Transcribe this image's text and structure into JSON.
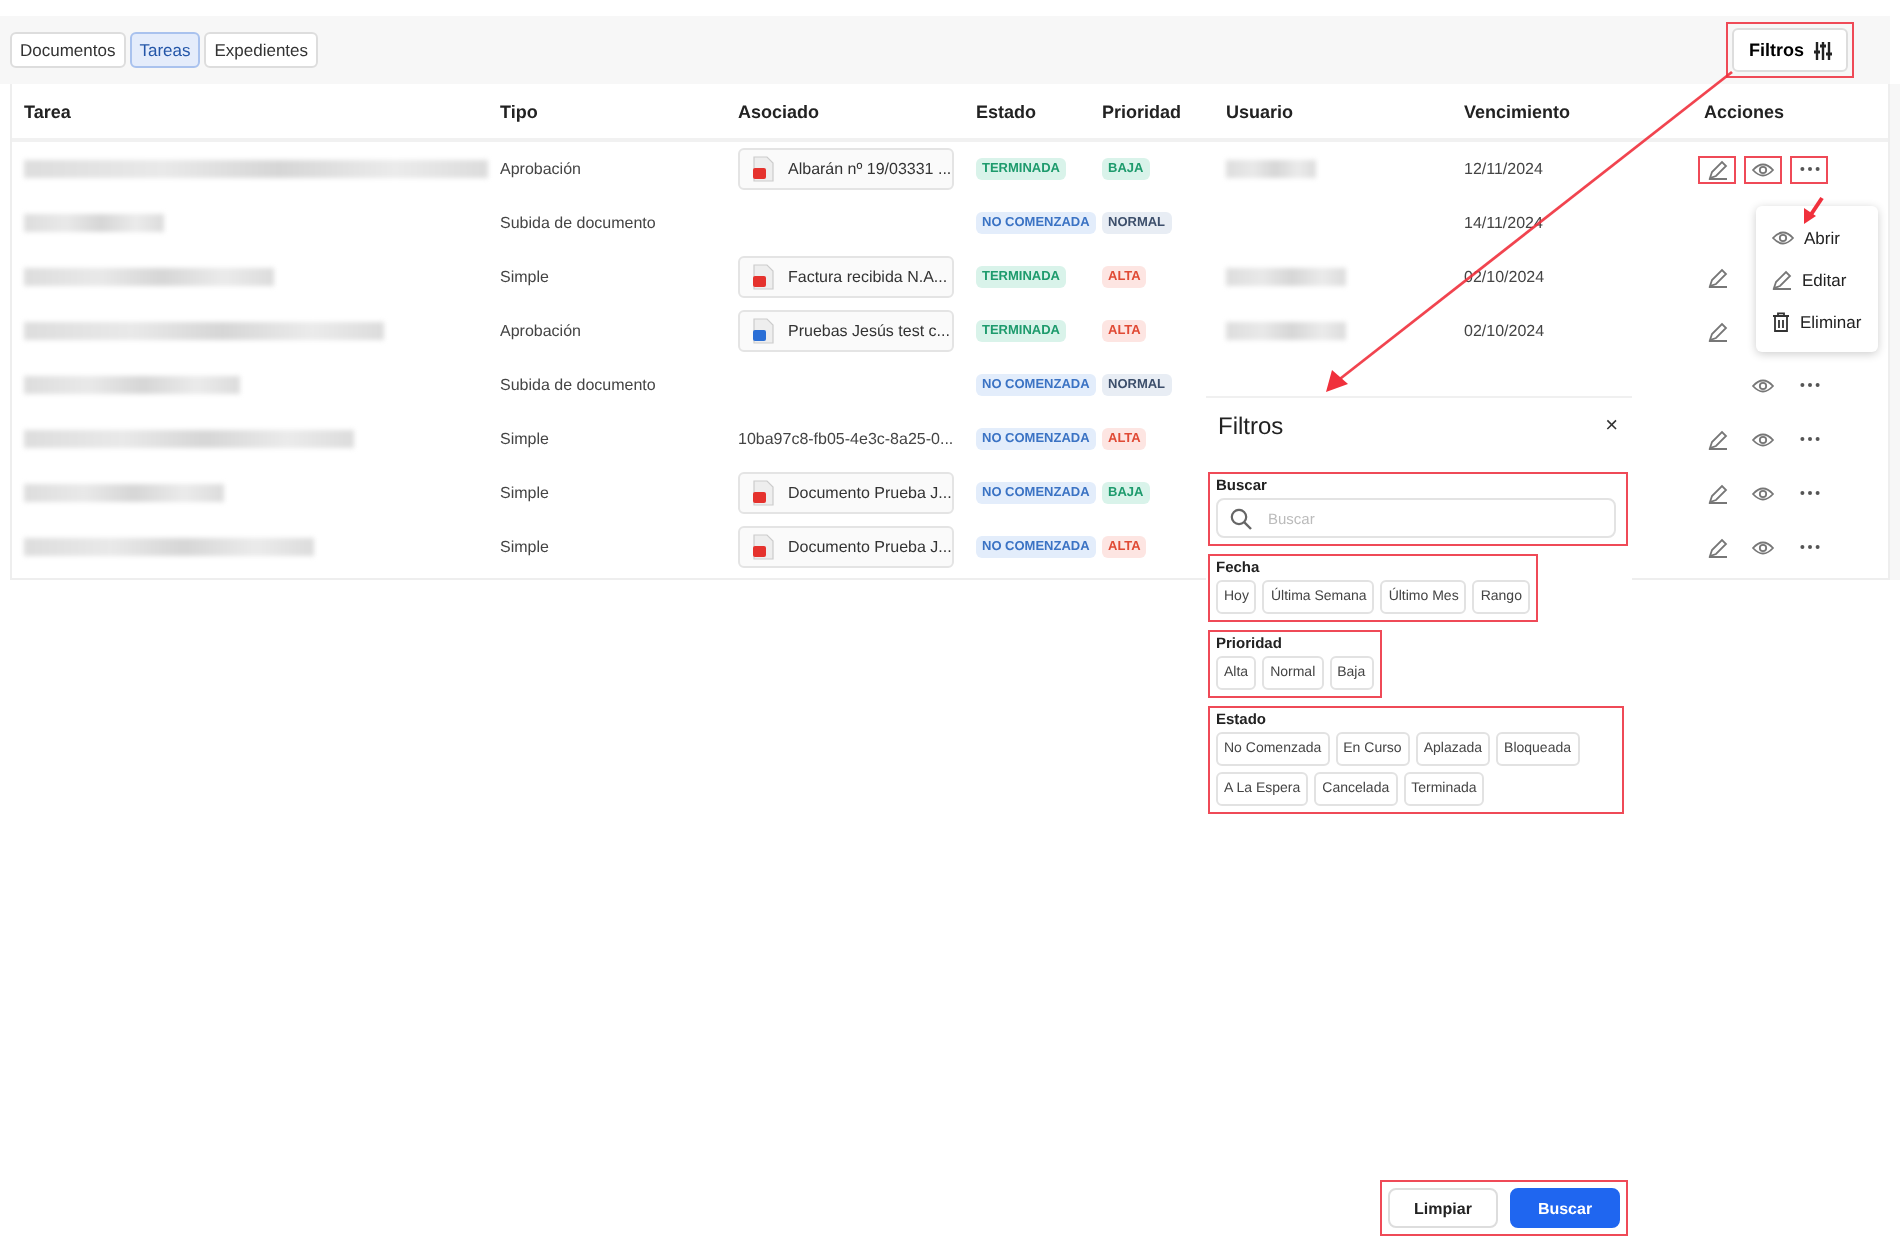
{
  "tabs": [
    {
      "label": "Documentos",
      "selected": false
    },
    {
      "label": "Tareas",
      "selected": true
    },
    {
      "label": "Expedientes",
      "selected": false
    }
  ],
  "filters_button": {
    "label": "Filtros",
    "highlighted": true
  },
  "table": {
    "columns": [
      "Tarea",
      "Tipo",
      "Asociado",
      "Estado",
      "Prioridad",
      "Usuario",
      "Vencimiento",
      "Acciones"
    ],
    "rows": [
      {
        "tipo": "Aprobación",
        "asociado": {
          "kind": "pdf",
          "text": "Albarán nº 19/03331 ..."
        },
        "estado": {
          "kind": "done",
          "text": "TERMINADA"
        },
        "prioridad": {
          "kind": "low",
          "text": "BAJA"
        },
        "usuario_redacted": true,
        "vencimiento": "12/11/2024",
        "actions": [
          {
            "kind": "edit",
            "highlighted": true
          },
          {
            "kind": "view",
            "highlighted": true
          },
          {
            "kind": "more",
            "highlighted": true
          }
        ]
      },
      {
        "tipo": "Subida de documento",
        "estado": {
          "kind": "new",
          "text": "NO COMENZADA"
        },
        "prioridad": {
          "kind": "normal",
          "text": "NORMAL"
        },
        "vencimiento": "14/11/2024"
      },
      {
        "tipo": "Simple",
        "asociado": {
          "kind": "pdf",
          "text": "Factura recibida N.A..."
        },
        "estado": {
          "kind": "done",
          "text": "TERMINADA"
        },
        "prioridad": {
          "kind": "high",
          "text": "ALTA"
        },
        "usuario_redacted": true,
        "vencimiento": "02/10/2024",
        "actions": [
          {
            "kind": "edit",
            "highlighted": false
          }
        ]
      },
      {
        "tipo": "Aprobación",
        "asociado": {
          "kind": "word",
          "text": "Pruebas Jesús test c..."
        },
        "estado": {
          "kind": "done",
          "text": "TERMINADA"
        },
        "prioridad": {
          "kind": "high",
          "text": "ALTA"
        },
        "usuario_redacted": true,
        "vencimiento": "02/10/2024",
        "actions": [
          {
            "kind": "edit",
            "highlighted": false
          }
        ]
      },
      {
        "tipo": "Subida de documento",
        "estado": {
          "kind": "new",
          "text": "NO COMENZADA"
        },
        "prioridad": {
          "kind": "normal",
          "text": "NORMAL"
        },
        "actions": [
          {
            "kind": "view",
            "highlighted": false
          },
          {
            "kind": "more",
            "highlighted": false
          }
        ]
      },
      {
        "tipo": "Simple",
        "asociado": {
          "kind": "text",
          "text": "10ba97c8-fb05-4e3c-8a25-0..."
        },
        "estado": {
          "kind": "new",
          "text": "NO COMENZADA"
        },
        "prioridad": {
          "kind": "high",
          "text": "ALTA"
        },
        "actions": [
          {
            "kind": "edit",
            "highlighted": false
          },
          {
            "kind": "view",
            "highlighted": false
          },
          {
            "kind": "more",
            "highlighted": false
          }
        ]
      },
      {
        "tipo": "Simple",
        "asociado": {
          "kind": "pdf",
          "text": "Documento Prueba J..."
        },
        "estado": {
          "kind": "new",
          "text": "NO COMENZADA"
        },
        "prioridad": {
          "kind": "low",
          "text": "BAJA"
        },
        "actions": [
          {
            "kind": "edit",
            "highlighted": false
          },
          {
            "kind": "view",
            "highlighted": false
          },
          {
            "kind": "more",
            "highlighted": false
          }
        ]
      },
      {
        "tipo": "Simple",
        "asociado": {
          "kind": "pdf",
          "text": "Documento Prueba J..."
        },
        "estado": {
          "kind": "new",
          "text": "NO COMENZADA"
        },
        "prioridad": {
          "kind": "high",
          "text": "ALTA"
        },
        "actions": [
          {
            "kind": "edit",
            "highlighted": false
          },
          {
            "kind": "view",
            "highlighted": false
          },
          {
            "kind": "more",
            "highlighted": false
          }
        ]
      }
    ]
  },
  "row_menu": {
    "items": [
      {
        "kind": "view",
        "label": "Abrir"
      },
      {
        "kind": "edit",
        "label": "Editar"
      },
      {
        "kind": "delete",
        "label": "Eliminar"
      }
    ]
  },
  "filter_panel": {
    "title": "Filtros",
    "close": "×",
    "sections": [
      {
        "kind": "search",
        "label": "Buscar",
        "placeholder": "Buscar",
        "highlighted": true
      },
      {
        "kind": "chips",
        "label": "Fecha",
        "highlighted": true,
        "options": [
          "Hoy",
          "Última Semana",
          "Último Mes",
          "Rango"
        ]
      },
      {
        "kind": "chips",
        "label": "Prioridad",
        "highlighted": true,
        "options": [
          "Alta",
          "Normal",
          "Baja"
        ]
      },
      {
        "kind": "chips",
        "label": "Estado",
        "highlighted": true,
        "options": [
          "No Comenzada",
          "En Curso",
          "Aplazada",
          "Bloqueada",
          "A La Espera",
          "Cancelada",
          "Terminada"
        ]
      }
    ],
    "footer": {
      "highlighted": true,
      "buttons": [
        {
          "kind": "secondary",
          "label": "Limpiar"
        },
        {
          "kind": "primary",
          "label": "Buscar"
        }
      ]
    }
  }
}
